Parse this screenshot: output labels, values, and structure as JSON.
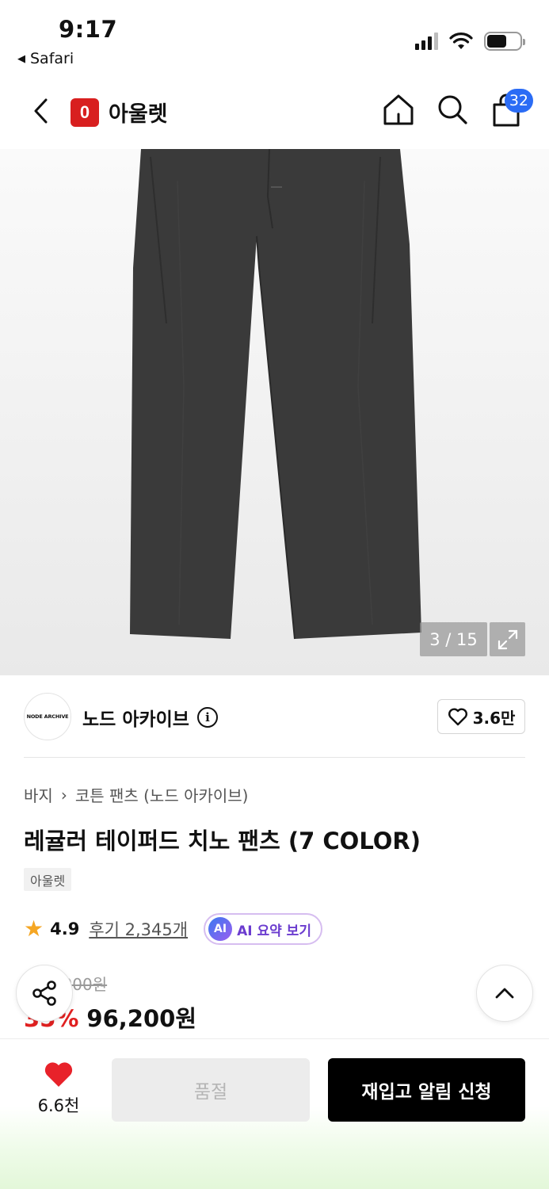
{
  "status_bar": {
    "time": "9:17",
    "back_app": "Safari"
  },
  "header": {
    "brand_logo_letter": "0",
    "brand_name": "아울렛",
    "cart_count": "32",
    "icons": [
      "back-chevron-icon",
      "home-icon",
      "search-icon",
      "cart-icon"
    ]
  },
  "gallery": {
    "counter": "3 / 15"
  },
  "brand": {
    "avatar_text": "NODE ARCHIVE",
    "name": "노드 아카이브",
    "likes": "3.6만"
  },
  "product": {
    "breadcrumb": [
      "바지",
      "코튼 팬츠 (노드 아카이브)"
    ],
    "title": "레귤러 테이퍼드 치노 팬츠 (7 COLOR)",
    "tag": "아울렛",
    "rating": "4.9",
    "review_link": "후기 2,345개",
    "ai_badge": "AI",
    "ai_summary_label": "AI 요약 보기",
    "original_price": "148,000원",
    "discount": "35%",
    "price": "96,200원"
  },
  "bottom_bar": {
    "wish_count": "6.6천",
    "soldout_label": "품절",
    "restock_label": "재입고 알림 신청"
  },
  "colors": {
    "brand_red": "#d81f1f",
    "badge_blue": "#2b6cf5",
    "discount_red": "#e02020",
    "star": "#f5a623",
    "ai_purple": "#6b3ccf"
  }
}
